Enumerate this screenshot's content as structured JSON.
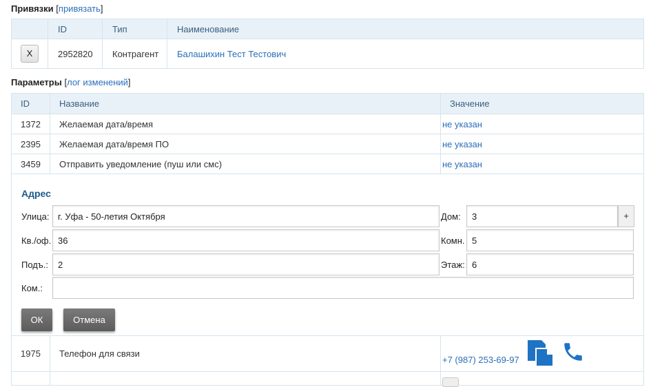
{
  "links_section": {
    "title": "Привязки",
    "open_bracket": "[",
    "action": "привязать",
    "close_bracket": "]",
    "columns": [
      "ID",
      "Тип",
      "Наименование"
    ],
    "rows": [
      {
        "remove_label": "X",
        "id": "2952820",
        "type": "Контрагент",
        "name": "Балашихин Тест Тестович"
      }
    ]
  },
  "params_section": {
    "title": "Параметры",
    "open_bracket": "[",
    "action": "лог изменений",
    "close_bracket": "]",
    "columns": [
      "ID",
      "Название",
      "Значение"
    ],
    "rows": [
      {
        "id": "1372",
        "name": "Желаемая дата/время",
        "value": "не указан"
      },
      {
        "id": "2395",
        "name": "Желаемая дата/время ПО",
        "value": "не указан"
      },
      {
        "id": "3459",
        "name": "Отправить уведомление (пуш или смс)",
        "value": "не указан"
      }
    ],
    "phone_row": {
      "id": "1975",
      "name": "Телефон для связи",
      "value": "+7 (987) 253-69-97"
    }
  },
  "address_form": {
    "title": "Адрес",
    "street_label": "Улица:",
    "street_value": "г. Уфа - 50-летия Октября",
    "house_label": "Дом:",
    "house_value": "3",
    "house_plus": "+",
    "apt_label": "Кв./оф.",
    "apt_value": "36",
    "room_label": "Комн.",
    "room_value": "5",
    "entrance_label": "Подъ.:",
    "entrance_value": "2",
    "floor_label": "Этаж:",
    "floor_value": "6",
    "comment_label": "Ком.:",
    "comment_value": "",
    "ok_label": "ОК",
    "cancel_label": "Отмена"
  },
  "colors": {
    "accent": "#2a6ebb",
    "header_bg": "#e8f1f8",
    "phone_icon": "#1f73c4"
  }
}
